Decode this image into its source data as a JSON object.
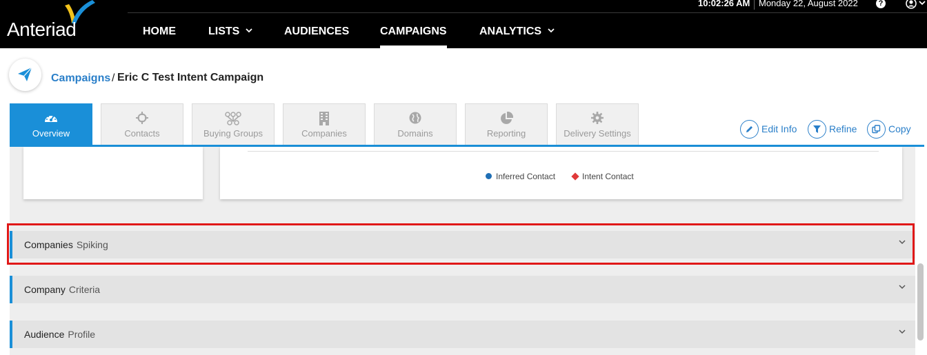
{
  "app": {
    "logo_text": "Anteriad",
    "time": "10:02:26  AM",
    "date": "Monday 22, August 2022"
  },
  "nav": {
    "items": [
      {
        "label": "HOME",
        "has_dropdown": false
      },
      {
        "label": "LISTS",
        "has_dropdown": true
      },
      {
        "label": "AUDIENCES",
        "has_dropdown": false
      },
      {
        "label": "CAMPAIGNS",
        "has_dropdown": false,
        "active": true
      },
      {
        "label": "ANALYTICS",
        "has_dropdown": true
      }
    ]
  },
  "breadcrumb": {
    "icon": "paper-plane-icon",
    "link": "Campaigns",
    "separator": "/",
    "current": "Eric C Test Intent Campaign"
  },
  "tabs": [
    {
      "label": "Overview",
      "icon": "dashboard-gauge-icon",
      "active": true
    },
    {
      "label": "Contacts",
      "icon": "crosshair-icon",
      "active": false
    },
    {
      "label": "Buying Groups",
      "icon": "group-icon",
      "active": false
    },
    {
      "label": "Companies",
      "icon": "building-icon",
      "active": false
    },
    {
      "label": "Domains",
      "icon": "globe-icon",
      "active": false
    },
    {
      "label": "Reporting",
      "icon": "pie-chart-icon",
      "active": false
    },
    {
      "label": "Delivery Settings",
      "icon": "gear-icon",
      "active": false
    }
  ],
  "actions": [
    {
      "label": "Edit Info",
      "icon": "pencil-icon"
    },
    {
      "label": "Refine",
      "icon": "filter-icon"
    },
    {
      "label": "Copy",
      "icon": "copy-icon"
    }
  ],
  "legend": [
    {
      "label": "Inferred Contact",
      "shape": "circle",
      "color": "#1f6fb5"
    },
    {
      "label": "Intent Contact",
      "shape": "diamond",
      "color": "#e03a3a"
    }
  ],
  "sections": [
    {
      "title": "Companies",
      "subtitle": "Spiking",
      "highlighted": true
    },
    {
      "title": "Company",
      "subtitle": "Criteria",
      "highlighted": false
    },
    {
      "title": "Audience",
      "subtitle": "Profile",
      "highlighted": false
    }
  ],
  "colors": {
    "accent": "#1a8fd8",
    "link": "#2a7fc9",
    "highlight": "#e01818",
    "topbar": "#000000"
  }
}
